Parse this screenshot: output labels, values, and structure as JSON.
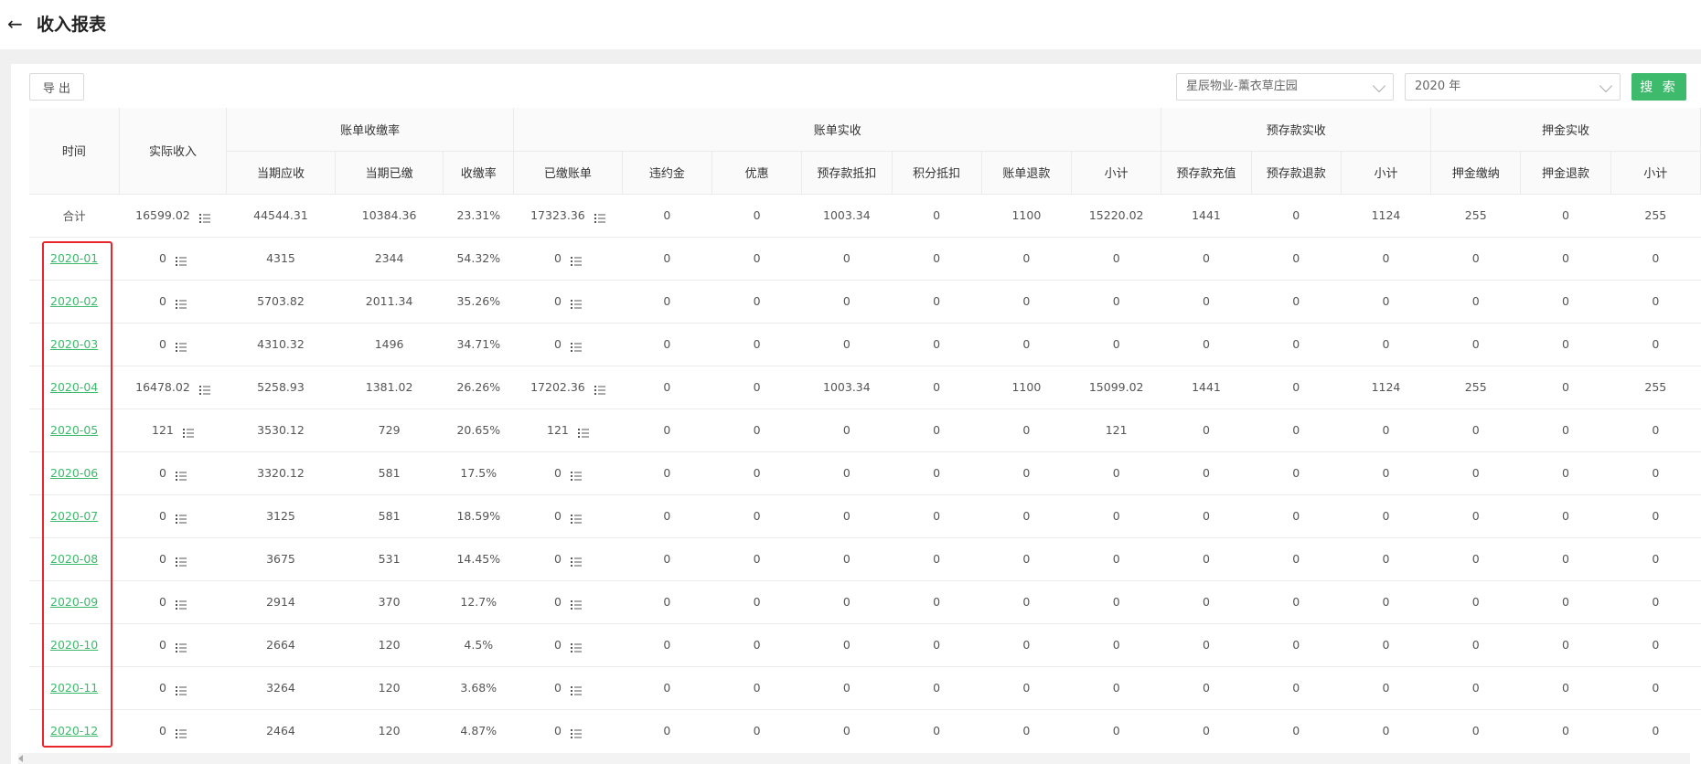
{
  "header": {
    "title": "收入报表"
  },
  "toolbar": {
    "export_label": "导 出",
    "property_select": "星辰物业-薰衣草庄园",
    "year_select": "2020 年",
    "search_label": "搜 索"
  },
  "columns": {
    "group1": {
      "time": "时间",
      "actual_income": "实际收入",
      "bill_rate": "账单收缴率",
      "bill_received": "账单实收",
      "prestore_received": "预存款实收",
      "deposit_received": "押金实收"
    },
    "group2": {
      "current_due": "当期应收",
      "current_paid": "当期已缴",
      "collection_rate": "收缴率",
      "paid_bills": "已缴账单",
      "late_fee": "违约金",
      "discount": "优惠",
      "prestore_deduct": "预存款抵扣",
      "points_deduct": "积分抵扣",
      "bill_refund": "账单退款",
      "subtotal1": "小计",
      "prestore_recharge": "预存款充值",
      "prestore_refund": "预存款退款",
      "subtotal2": "小计",
      "deposit_pay": "押金缴纳",
      "deposit_refund": "押金退款",
      "subtotal3": "小计"
    }
  },
  "rows": [
    [
      "合计",
      "16599.02",
      "44544.31",
      "10384.36",
      "23.31%",
      "17323.36",
      "0",
      "0",
      "1003.34",
      "0",
      "1100",
      "15220.02",
      "1441",
      "0",
      "1124",
      "255",
      "0",
      "255"
    ],
    [
      "2020-01",
      "0",
      "4315",
      "2344",
      "54.32%",
      "0",
      "0",
      "0",
      "0",
      "0",
      "0",
      "0",
      "0",
      "0",
      "0",
      "0",
      "0",
      "0"
    ],
    [
      "2020-02",
      "0",
      "5703.82",
      "2011.34",
      "35.26%",
      "0",
      "0",
      "0",
      "0",
      "0",
      "0",
      "0",
      "0",
      "0",
      "0",
      "0",
      "0",
      "0"
    ],
    [
      "2020-03",
      "0",
      "4310.32",
      "1496",
      "34.71%",
      "0",
      "0",
      "0",
      "0",
      "0",
      "0",
      "0",
      "0",
      "0",
      "0",
      "0",
      "0",
      "0"
    ],
    [
      "2020-04",
      "16478.02",
      "5258.93",
      "1381.02",
      "26.26%",
      "17202.36",
      "0",
      "0",
      "1003.34",
      "0",
      "1100",
      "15099.02",
      "1441",
      "0",
      "1124",
      "255",
      "0",
      "255"
    ],
    [
      "2020-05",
      "121",
      "3530.12",
      "729",
      "20.65%",
      "121",
      "0",
      "0",
      "0",
      "0",
      "0",
      "121",
      "0",
      "0",
      "0",
      "0",
      "0",
      "0"
    ],
    [
      "2020-06",
      "0",
      "3320.12",
      "581",
      "17.5%",
      "0",
      "0",
      "0",
      "0",
      "0",
      "0",
      "0",
      "0",
      "0",
      "0",
      "0",
      "0",
      "0"
    ],
    [
      "2020-07",
      "0",
      "3125",
      "581",
      "18.59%",
      "0",
      "0",
      "0",
      "0",
      "0",
      "0",
      "0",
      "0",
      "0",
      "0",
      "0",
      "0",
      "0"
    ],
    [
      "2020-08",
      "0",
      "3675",
      "531",
      "14.45%",
      "0",
      "0",
      "0",
      "0",
      "0",
      "0",
      "0",
      "0",
      "0",
      "0",
      "0",
      "0",
      "0"
    ],
    [
      "2020-09",
      "0",
      "2914",
      "370",
      "12.7%",
      "0",
      "0",
      "0",
      "0",
      "0",
      "0",
      "0",
      "0",
      "0",
      "0",
      "0",
      "0",
      "0"
    ],
    [
      "2020-10",
      "0",
      "2664",
      "120",
      "4.5%",
      "0",
      "0",
      "0",
      "0",
      "0",
      "0",
      "0",
      "0",
      "0",
      "0",
      "0",
      "0",
      "0"
    ],
    [
      "2020-11",
      "0",
      "3264",
      "120",
      "3.68%",
      "0",
      "0",
      "0",
      "0",
      "0",
      "0",
      "0",
      "0",
      "0",
      "0",
      "0",
      "0",
      "0"
    ],
    [
      "2020-12",
      "0",
      "2464",
      "120",
      "4.87%",
      "0",
      "0",
      "0",
      "0",
      "0",
      "0",
      "0",
      "0",
      "0",
      "0",
      "0",
      "0",
      "0"
    ]
  ],
  "colors": {
    "accent": "#3dba6b",
    "highlight_border": "#e8252b"
  }
}
